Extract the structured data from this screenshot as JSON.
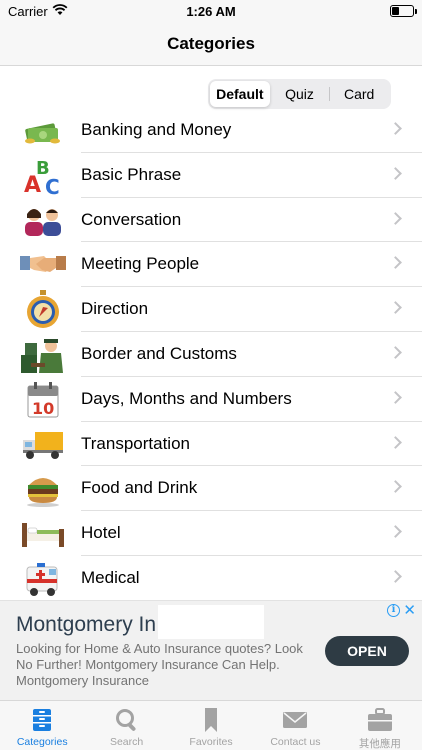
{
  "status_bar": {
    "carrier": "Carrier",
    "time": "1:26 AM",
    "battery_level": 0.35
  },
  "nav": {
    "title": "Categories"
  },
  "segmented": {
    "options": [
      "Default",
      "Quiz",
      "Card"
    ],
    "selected": "Default"
  },
  "categories": [
    {
      "label": "Banking and Money",
      "icon": "money-icon"
    },
    {
      "label": "Basic Phrase",
      "icon": "abc-letters-icon"
    },
    {
      "label": "Conversation",
      "icon": "people-talking-icon"
    },
    {
      "label": "Meeting People",
      "icon": "handshake-icon"
    },
    {
      "label": "Direction",
      "icon": "compass-icon"
    },
    {
      "label": "Border and Customs",
      "icon": "customs-officer-icon"
    },
    {
      "label": "Days, Months and Numbers",
      "icon": "calendar-icon"
    },
    {
      "label": "Transportation",
      "icon": "truck-icon"
    },
    {
      "label": "Food and Drink",
      "icon": "burger-icon"
    },
    {
      "label": "Hotel",
      "icon": "bed-icon"
    },
    {
      "label": "Medical",
      "icon": "ambulance-icon"
    }
  ],
  "ad": {
    "title": "Montgomery In",
    "body": "Looking for Home & Auto Insurance quotes? Look No Further! Montgomery Insurance Can Help. Montgomery Insurance",
    "button": "OPEN",
    "info_glyph": "i",
    "close_glyph": "✕"
  },
  "tabs": [
    {
      "label": "Categories",
      "icon": "categories-drawer-icon",
      "active": true
    },
    {
      "label": "Search",
      "icon": "search-icon",
      "active": false
    },
    {
      "label": "Favorites",
      "icon": "bookmark-icon",
      "active": false
    },
    {
      "label": "Contact us",
      "icon": "envelope-icon",
      "active": false
    },
    {
      "label": "其他應用",
      "icon": "briefcase-icon",
      "active": false
    }
  ],
  "colors": {
    "accent": "#1a7fe0",
    "tab_inactive": "#a3a3a3",
    "ad_button": "#2e3b44"
  }
}
